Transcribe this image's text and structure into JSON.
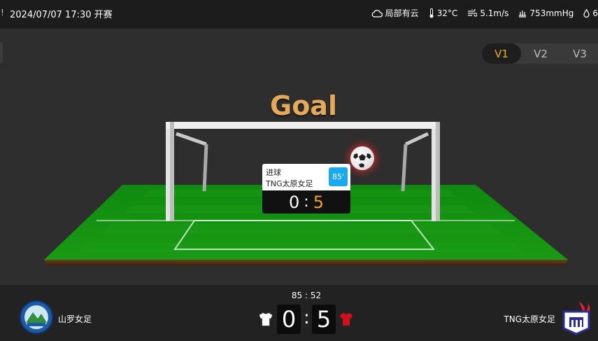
{
  "header": {
    "mark": "!",
    "match_time": "2024/07/07 17:30 开赛",
    "weather": {
      "condition": "局部有云",
      "temperature": "32°C",
      "wind": "5.1m/s",
      "pressure": "753mmHg",
      "humidity": "6"
    }
  },
  "view_tabs": [
    {
      "label": "V1",
      "active": true
    },
    {
      "label": "V2",
      "active": false
    },
    {
      "label": "V3",
      "active": false
    }
  ],
  "animation": {
    "title": "Goal",
    "event": {
      "type": "进球",
      "team": "TNG太原女足",
      "minute": "85'",
      "home_score": "0",
      "away_score": "5",
      "separator": ":"
    }
  },
  "scoreboard": {
    "half_time": "85 : 52",
    "home": {
      "name": "山罗女足",
      "score": "0",
      "shirt_color": "#ffffff"
    },
    "away": {
      "name": "TNG太原女足",
      "score": "5",
      "shirt_color": "#d0101a"
    },
    "separator": ":"
  },
  "colors": {
    "accent": "#f0b020",
    "minute_badge": "#18a9ee",
    "pitch": "#138a10"
  }
}
